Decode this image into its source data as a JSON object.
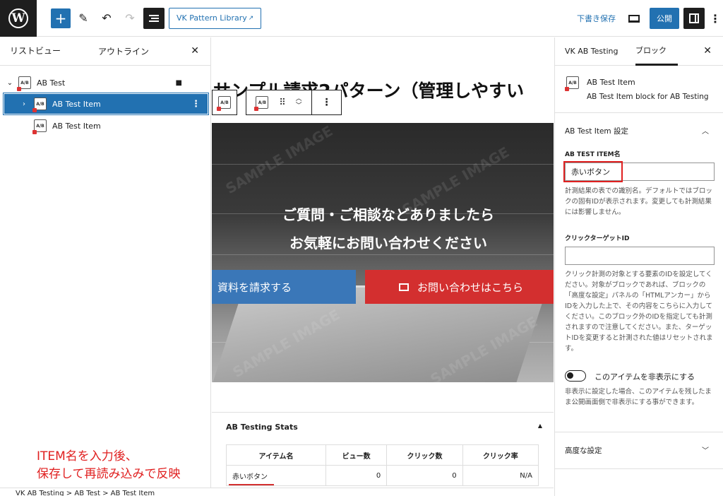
{
  "toolbar": {
    "pattern_library": "VK Pattern Library",
    "external_mark": "↗",
    "save_draft": "下書き保存",
    "publish": "公開",
    "more": "⋮"
  },
  "list_view": {
    "tab_list": "リストビュー",
    "tab_outline": "アウトライン",
    "close": "✕",
    "items": [
      {
        "label": "AB Test",
        "chevron": "⌄"
      },
      {
        "label": "AB Test Item",
        "chevron": "›",
        "selected": true
      },
      {
        "label": "AB Test Item"
      }
    ],
    "icon_text": "A/B",
    "lock": "🔒"
  },
  "canvas": {
    "heading": "サンプル請求2パターン（管理しやすい",
    "hero_line1": "ご質問・ご相談などありましたら",
    "hero_line2": "お気軽にお問い合わせください",
    "watermark": "SAMPLE IMAGE",
    "btn_blue": "資料を請求する",
    "btn_red": "お問い合わせはこちら",
    "toolbar_drag": "⠿",
    "toolbar_up": "︿",
    "toolbar_down": "﹀",
    "toolbar_more": "⋮"
  },
  "stats": {
    "title": "AB Testing Stats",
    "caret": "▲",
    "headers": [
      "アイテム名",
      "ビュー数",
      "クリック数",
      "クリック率"
    ],
    "rows": [
      [
        "赤いボタン",
        "0",
        "0",
        "N/A"
      ]
    ]
  },
  "annotation": {
    "line1": "ITEM名を入力後、",
    "line2": "保存して再読み込みで反映"
  },
  "breadcrumb": "VK AB Testing  >  AB Test  >  AB Test Item",
  "sidebar": {
    "tab_plugin": "VK AB Testing",
    "tab_block": "ブロック",
    "close": "✕",
    "block_title": "AB Test Item",
    "block_desc": "AB Test Item block for AB Testing",
    "settings_title": "AB Test Item 設定",
    "item_name_label": "AB TEST ITEM名",
    "item_name_value": "赤いボタン",
    "item_name_help": "計測結果の表での識別名。デフォルトではブロックの固有IDが表示されます。変更しても計測結果には影響しません。",
    "click_target_label": "クリックターゲットID",
    "click_target_value": "",
    "click_target_help": "クリック計測の対象とする要素のIDを設定してください。対象がブロックであれば、ブロックの「高度な設定」パネルの「HTMLアンカー」からIDを入力した上で、その内容をこちらに入力してください。このブロック外のIDを指定しても計測されますので注意してください。また、ターゲットIDを変更すると計測された値はリセットされます。",
    "hide_toggle_label": "このアイテムを非表示にする",
    "hide_help": "非表示に設定した場合、このアイテムを残したまま公開画面側で非表示にする事ができます。",
    "advanced": "高度な設定",
    "chev_up": "︿",
    "chev_down": "﹀"
  },
  "colors": {
    "accent": "#2271b1",
    "button_blue": "#3a77b8",
    "button_red": "#d32f2f",
    "annotation_red": "#e02020"
  }
}
